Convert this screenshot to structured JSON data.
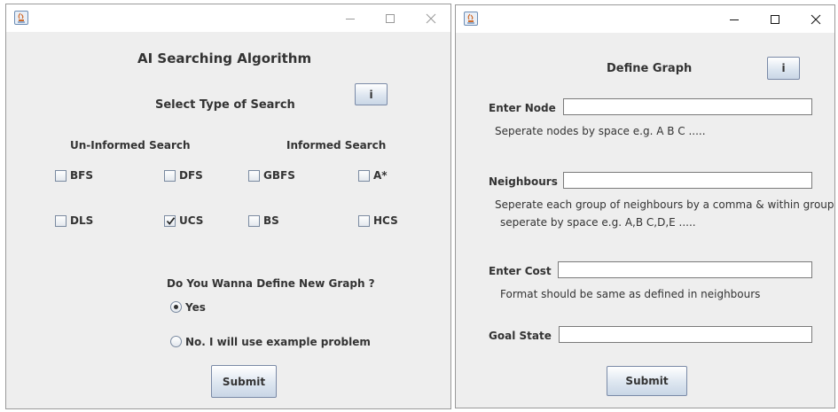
{
  "left_window": {
    "title": "AI Searching Algorithm",
    "select_heading": "Select Type of Search",
    "info_button": "i",
    "uninformed_heading": "Un-Informed Search",
    "informed_heading": "Informed Search",
    "checkboxes": [
      {
        "label": "BFS",
        "checked": false
      },
      {
        "label": "DFS",
        "checked": false
      },
      {
        "label": "GBFS",
        "checked": false
      },
      {
        "label": "A*",
        "checked": false
      },
      {
        "label": "DLS",
        "checked": false
      },
      {
        "label": "UCS",
        "checked": true
      },
      {
        "label": "BS",
        "checked": false
      },
      {
        "label": "HCS",
        "checked": false
      }
    ],
    "graph_question": "Do You Wanna Define New Graph ?",
    "radio_yes": "Yes",
    "radio_no": "No. I will use example problem",
    "radio_selected": "Yes",
    "submit_label": "Submit"
  },
  "right_window": {
    "title": "Define Graph",
    "info_button": "i",
    "node_label": "Enter Node",
    "node_value": "",
    "node_hint": "Seperate nodes by space e.g. A B C .....",
    "neighbours_label": "Neighbours",
    "neighbours_value": "",
    "neighbours_hint_1": "Seperate each group of neighbours by a comma & within group",
    "neighbours_hint_2": "seperate by space e.g. A,B C,D,E .....",
    "cost_label": "Enter Cost",
    "cost_value": "",
    "cost_hint": "Format should be same as defined in neighbours",
    "goal_label": "Goal State",
    "goal_value": "",
    "submit_label": "Submit"
  }
}
